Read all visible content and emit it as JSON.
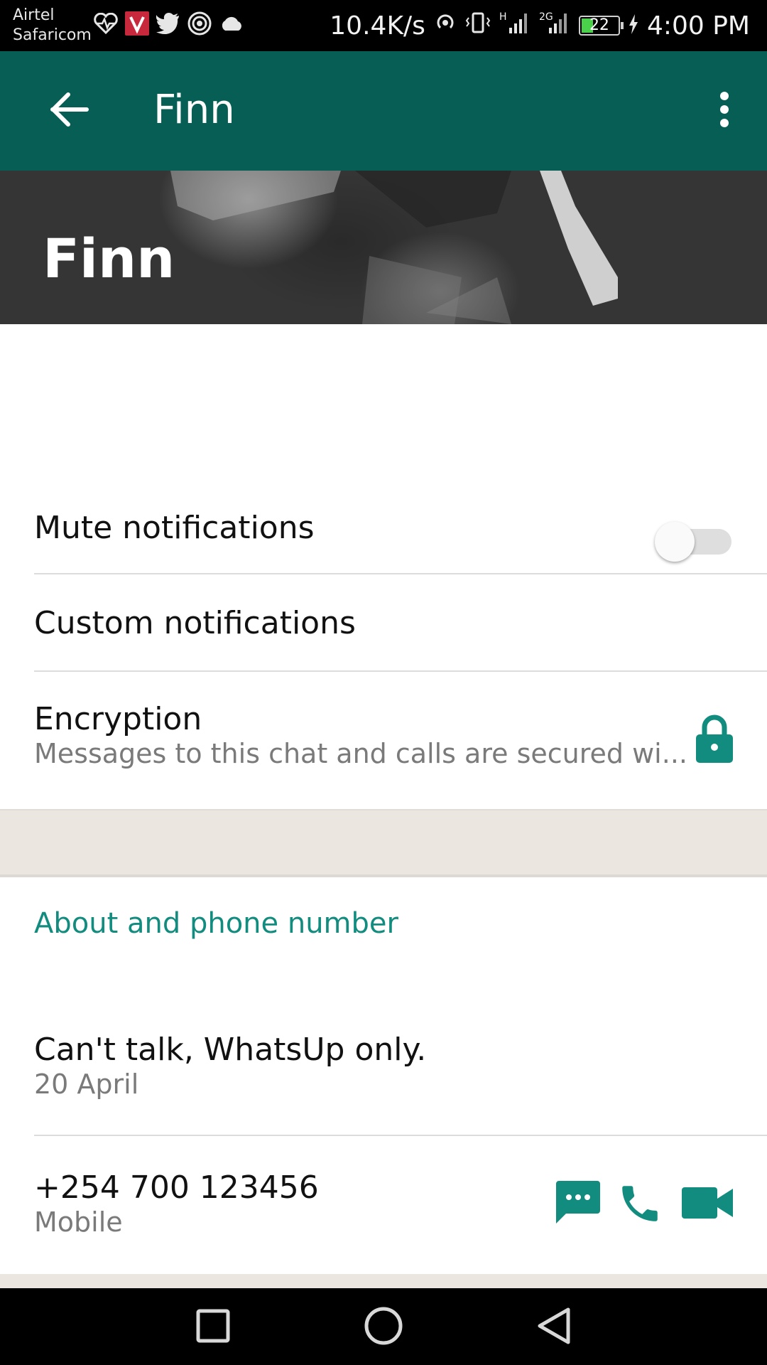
{
  "status_bar": {
    "carrier_1": "Airtel",
    "carrier_2": "Safaricom",
    "speed": "10.4K/s",
    "network_1": "H",
    "network_2": "2G",
    "battery": "22",
    "time": "4:00 PM",
    "icons_left": [
      "heartbeat-icon",
      "v-app-icon",
      "twitter-icon",
      "hotspot-icon",
      "cloud-icon"
    ]
  },
  "app_bar": {
    "title": "Finn",
    "back_icon": "arrow-back-icon",
    "menu_icon": "more-vert-icon",
    "color": "#075e54"
  },
  "hero": {
    "name": "Finn"
  },
  "settings": {
    "mute": {
      "label": "Mute notifications",
      "enabled": false
    },
    "custom": {
      "label": "Custom notifications"
    },
    "encryption": {
      "title": "Encryption",
      "subtitle": "Messages to this chat and calls are secured wi...",
      "icon": "lock-icon"
    }
  },
  "about_section": {
    "header": "About and phone number",
    "about": {
      "text": "Can't talk, WhatsUp only.",
      "date": "20 April"
    },
    "phone": {
      "number": "+254 700 123456",
      "type": "Mobile",
      "actions": [
        "message-icon",
        "phone-icon",
        "video-call-icon"
      ]
    },
    "accent_color": "#128c7e"
  },
  "nav_bar": {
    "buttons": [
      "recents-icon",
      "home-icon",
      "back-icon"
    ]
  }
}
